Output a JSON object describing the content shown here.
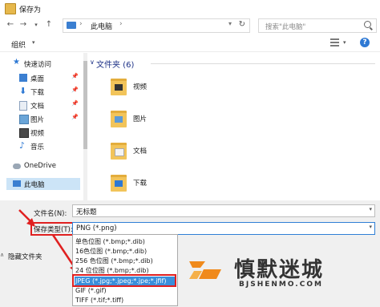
{
  "window": {
    "title": "保存为"
  },
  "address": {
    "location": "此电脑",
    "separator": "›"
  },
  "search": {
    "placeholder": "搜索\"此电脑\""
  },
  "toolbar": {
    "organize_label": "组织",
    "help_label": "?"
  },
  "nav": {
    "quick_access": "快速访问",
    "items": [
      {
        "label": "桌面",
        "icon": "desktop-icon",
        "pinned": true
      },
      {
        "label": "下载",
        "icon": "download-icon",
        "pinned": true
      },
      {
        "label": "文档",
        "icon": "document-icon",
        "pinned": true
      },
      {
        "label": "图片",
        "icon": "picture-icon",
        "pinned": true
      },
      {
        "label": "视频",
        "icon": "video-icon",
        "pinned": false
      },
      {
        "label": "音乐",
        "icon": "music-icon",
        "pinned": false
      }
    ],
    "onedrive": "OneDrive",
    "this_pc": "此电脑"
  },
  "content": {
    "group_header": "文件夹 (6)",
    "folders": [
      {
        "label": "视频",
        "icon": "video-folder-icon"
      },
      {
        "label": "图片",
        "icon": "picture-folder-icon"
      },
      {
        "label": "文档",
        "icon": "document-folder-icon"
      },
      {
        "label": "下载",
        "icon": "download-folder-icon"
      }
    ]
  },
  "form": {
    "filename_label": "文件名(N):",
    "filename_value": "无标题",
    "filetype_label": "保存类型(T):",
    "filetype_value": "PNG (*.png)",
    "hide_folders_label": "隐藏文件夹"
  },
  "filetype_options": [
    "单色位图 (*.bmp;*.dib)",
    "16色位图 (*.bmp;*.dib)",
    "256 色位图 (*.bmp;*.dib)",
    "24 位位图 (*.bmp;*.dib)",
    "JPEG (*.jpg;*.jpeg;*.jpe;*.jfif)",
    "GIF (*.gif)",
    "TIFF (*.tif;*.tiff)"
  ],
  "selected_option_index": 4,
  "watermark": {
    "title": "慎默迷城",
    "subtitle": "BJSHENMO.COM"
  },
  "colors": {
    "accent": "#2f7fd6",
    "highlight": "#e02020",
    "selection": "#3a8fdb"
  }
}
